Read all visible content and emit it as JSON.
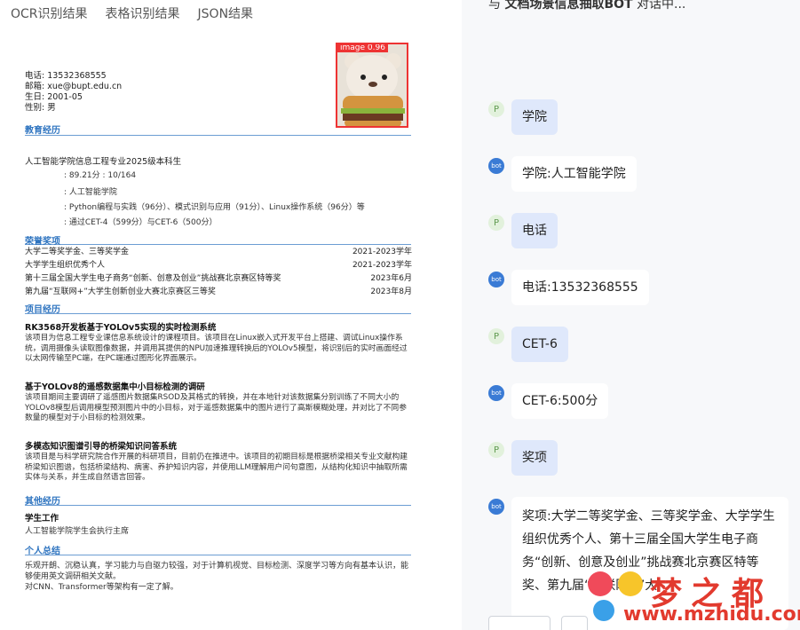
{
  "tabs": [
    "OCR识别结果",
    "表格识别结果",
    "JSON结果"
  ],
  "resume": {
    "photo_label": "image 0.96",
    "info": [
      "电话: 13532368555",
      "邮箱: xue@bupt.edu.cn",
      "生日: 2001-05",
      "性别: 男"
    ],
    "sections": {
      "education": "教育经历",
      "awards": "荣誉奖项",
      "projects": "项目经历",
      "other": "其他经历",
      "summary": "个人总结"
    },
    "education": {
      "main": "人工智能学院信息工程专业2025级本科生",
      "lines": [
        ": 89.21分          : 10/164",
        ": 人工智能学院",
        ": Python编程与实践（96分）、模式识别与应用（91分）、Linux操作系统（96分）等",
        ": 通过CET-4（599分）与CET-6（500分）"
      ]
    },
    "awards": [
      {
        "name": "大学二等奖学金、三等奖学金",
        "date": "2021-2023学年"
      },
      {
        "name": "大学学生组织优秀个人",
        "date": "2021-2023学年"
      },
      {
        "name": "第十三届全国大学生电子商务“创新、创意及创业”挑战赛北京赛区特等奖",
        "date": "2023年6月"
      },
      {
        "name": "第九届“互联网+”大学生创新创业大赛北京赛区三等奖",
        "date": "2023年8月"
      }
    ],
    "projects": [
      {
        "title": "RK3568开发板基于YOLOv5实现的实时检测系统",
        "desc": "该项目为信息工程专业课信息系统设计的课程项目。该项目在Linux嵌入式开发平台上搭建、调试Linux操作系统，调用摄像头读取图像数据，并调用其提供的NPU加速推理转换后的YOLOv5模型，将识别后的实时画面经过以太网传输至PC端，在PC端通过图形化界面展示。"
      },
      {
        "title": "基于YOLOv8的遥感数据集中小目标检测的调研",
        "desc": "该项目期间主要调研了遥感图片数据集RSOD及其格式的转换，并在本地针对该数据集分别训练了不同大小的YOLOv8模型后调用模型预测图片中的小目标，对于遥感数据集中的图片进行了高斯模糊处理，并对比了不同参数量的模型对于小目标的检测效果。"
      },
      {
        "title": "多模态知识图谱引导的桥梁知识问答系统",
        "desc": "该项目是与科学研究院合作开展的科研项目，目前仍在推进中。该项目的初期目标是根据桥梁相关专业文献构建桥梁知识图谱，包括桥梁结构、病害、养护知识内容，并使用LLM理解用户问句意图，从结构化知识中抽取所需实体与关系，并生成自然语言回答。"
      }
    ],
    "other": {
      "title": "学生工作",
      "text": "人工智能学院学生会执行主席"
    },
    "summary": "乐观开朗、沉稳认真，学习能力与自驱力较强，对于计算机视觉、目标检测、深度学习等方向有基本认识，能够使用英文调研相关文献。\n对CNN、Transformer等架构有一定了解。"
  },
  "chat": {
    "header_prefix": "与",
    "header_bot": "文档场景信息抽取BOT",
    "header_suffix": "对话中...",
    "user_avatar": "P",
    "bot_avatar": "bot",
    "messages": [
      {
        "role": "user",
        "text": "学院"
      },
      {
        "role": "bot",
        "text": "学院:人工智能学院"
      },
      {
        "role": "user",
        "text": "电话"
      },
      {
        "role": "bot",
        "text": "电话:13532368555"
      },
      {
        "role": "user",
        "text": "CET-6"
      },
      {
        "role": "bot",
        "text": "CET-6:500分"
      },
      {
        "role": "user",
        "text": "奖项"
      },
      {
        "role": "bot",
        "text": "奖项:大学二等奖学金、三等奖学金、大学学生组织优秀个人、第十三届全国大学生电子商务“创新、创意及创业”挑战赛北京赛区特等奖、第九届“互联网+”大"
      }
    ]
  },
  "watermark": {
    "text": "梦之都",
    "url": "www.mzhidu.com"
  }
}
